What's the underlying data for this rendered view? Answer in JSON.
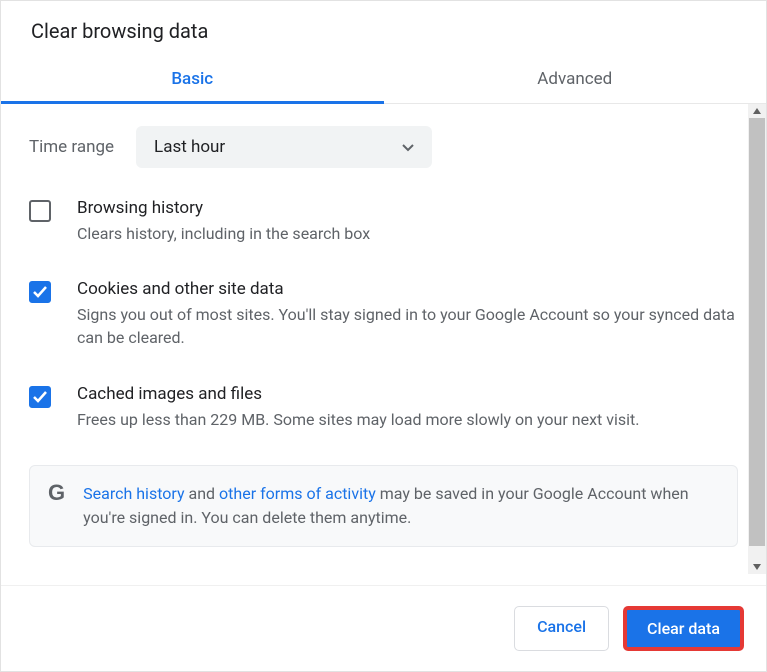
{
  "dialog": {
    "title": "Clear browsing data",
    "tabs": {
      "basic": "Basic",
      "advanced": "Advanced"
    },
    "timeRange": {
      "label": "Time range",
      "selected": "Last hour"
    },
    "options": [
      {
        "checked": false,
        "title": "Browsing history",
        "desc": "Clears history, including in the search box"
      },
      {
        "checked": true,
        "title": "Cookies and other site data",
        "desc": "Signs you out of most sites. You'll stay signed in to your Google Account so your synced data can be cleared."
      },
      {
        "checked": true,
        "title": "Cached images and files",
        "desc": "Frees up less than 229 MB. Some sites may load more slowly on your next visit."
      }
    ],
    "info": {
      "link1": "Search history",
      "mid1": " and ",
      "link2": "other forms of activity",
      "tail": " may be saved in your Google Account when you're signed in. You can delete them anytime."
    },
    "buttons": {
      "cancel": "Cancel",
      "clear": "Clear data"
    }
  }
}
